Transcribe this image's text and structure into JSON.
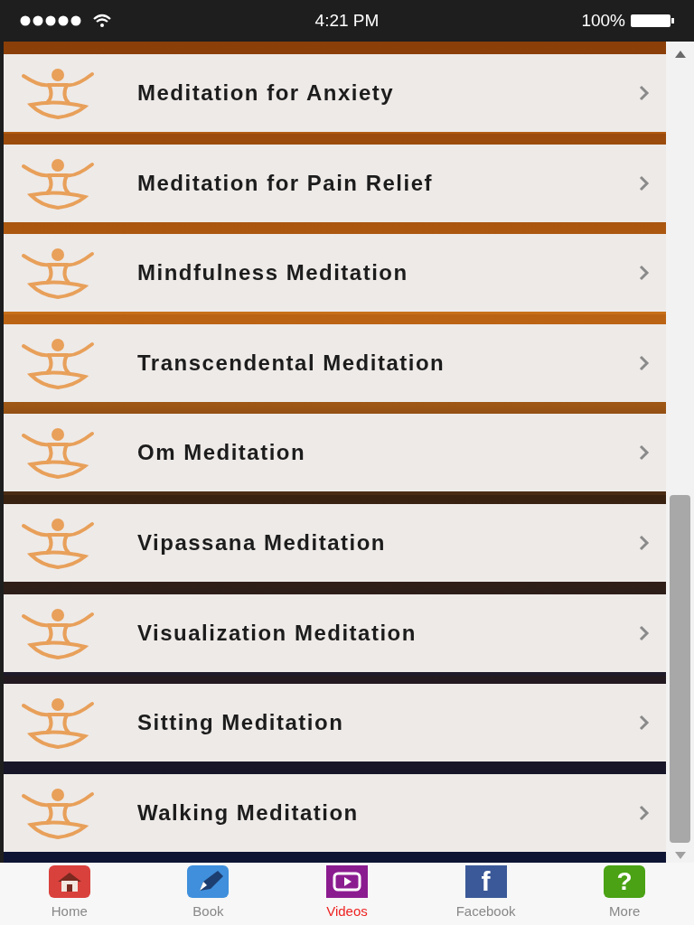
{
  "status_bar": {
    "time": "4:21 PM",
    "battery": "100%"
  },
  "items": [
    {
      "label": "Meditation for Anxiety"
    },
    {
      "label": "Meditation for Pain Relief"
    },
    {
      "label": "Mindfulness Meditation"
    },
    {
      "label": "Transcendental Meditation"
    },
    {
      "label": "Om Meditation"
    },
    {
      "label": "Vipassana Meditation"
    },
    {
      "label": "Visualization Meditation"
    },
    {
      "label": "Sitting Meditation"
    },
    {
      "label": "Walking Meditation"
    }
  ],
  "tab_bar": [
    {
      "kind": "home",
      "label": "Home",
      "selected": false
    },
    {
      "kind": "book",
      "label": "Book",
      "selected": false
    },
    {
      "kind": "videos",
      "label": "Videos",
      "selected": true
    },
    {
      "kind": "facebook",
      "label": "Facebook",
      "glyph": "f",
      "selected": false
    },
    {
      "kind": "more",
      "label": "More",
      "glyph": "?",
      "selected": false
    }
  ]
}
